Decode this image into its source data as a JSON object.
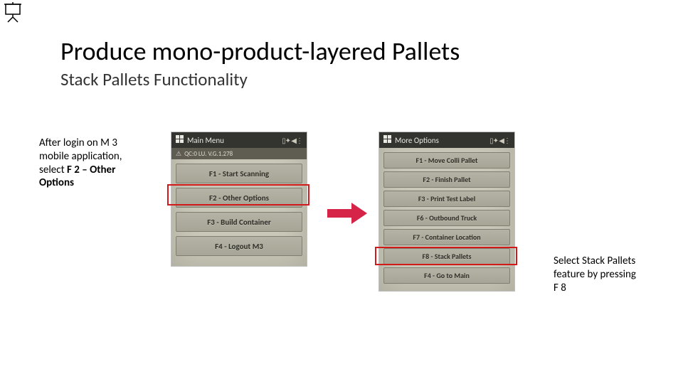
{
  "title": "Produce mono-product-layered Pallets",
  "subtitle": "Stack Pallets Functionality",
  "caption_left": {
    "line1": "After login on M 3",
    "line2": "mobile application,",
    "line3_a": "select ",
    "line3_b": "F 2 – Other",
    "line4": "Options"
  },
  "caption_right": {
    "line1": "Select Stack Pallets",
    "line2": "feature by pressing",
    "line3": "F 8"
  },
  "phone1": {
    "header": "Main Menu",
    "status": "QC:0 LU. V.G.1.278",
    "buttons": [
      "F1 - Start Scanning",
      "F2 - Other Options",
      "F3 - Build Container",
      "F4 - Logout M3"
    ]
  },
  "phone2": {
    "header": "More Options",
    "buttons": [
      "F1 - Move Colli Pallet",
      "F2 - Finish Pallet",
      "F3 - Print Test Label",
      "F6 - Outbound Truck",
      "F7 - Container Location",
      "F8 - Stack Pallets",
      "F4 - Go to Main"
    ]
  }
}
